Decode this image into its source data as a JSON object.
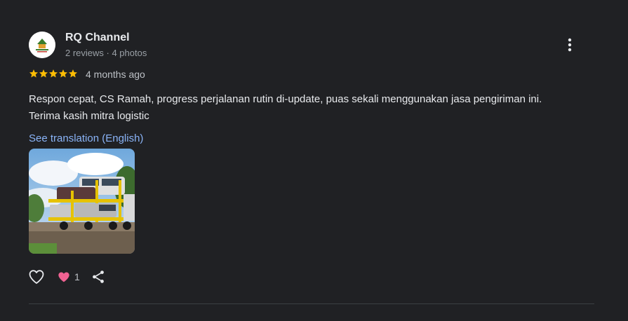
{
  "review": {
    "reviewer_name": "RQ Channel",
    "reviewer_meta": "2 reviews · 4 photos",
    "rating": 5,
    "date": "4 months ago",
    "text": "Respon cepat, CS Ramah, progress perjalanan rutin di-update, puas sekali menggunakan jasa pengiriman ini. Terima kasih mitra logistic",
    "translate_label": "See translation (English)",
    "reaction_count": "1",
    "star_color": "#fbbc04",
    "link_color": "#8ab4f8",
    "heart_color": "#f06292"
  },
  "icons": {
    "more": "more-vert-icon",
    "like": "heart-outline-icon",
    "reaction": "heart-filled-icon",
    "share": "share-icon"
  }
}
